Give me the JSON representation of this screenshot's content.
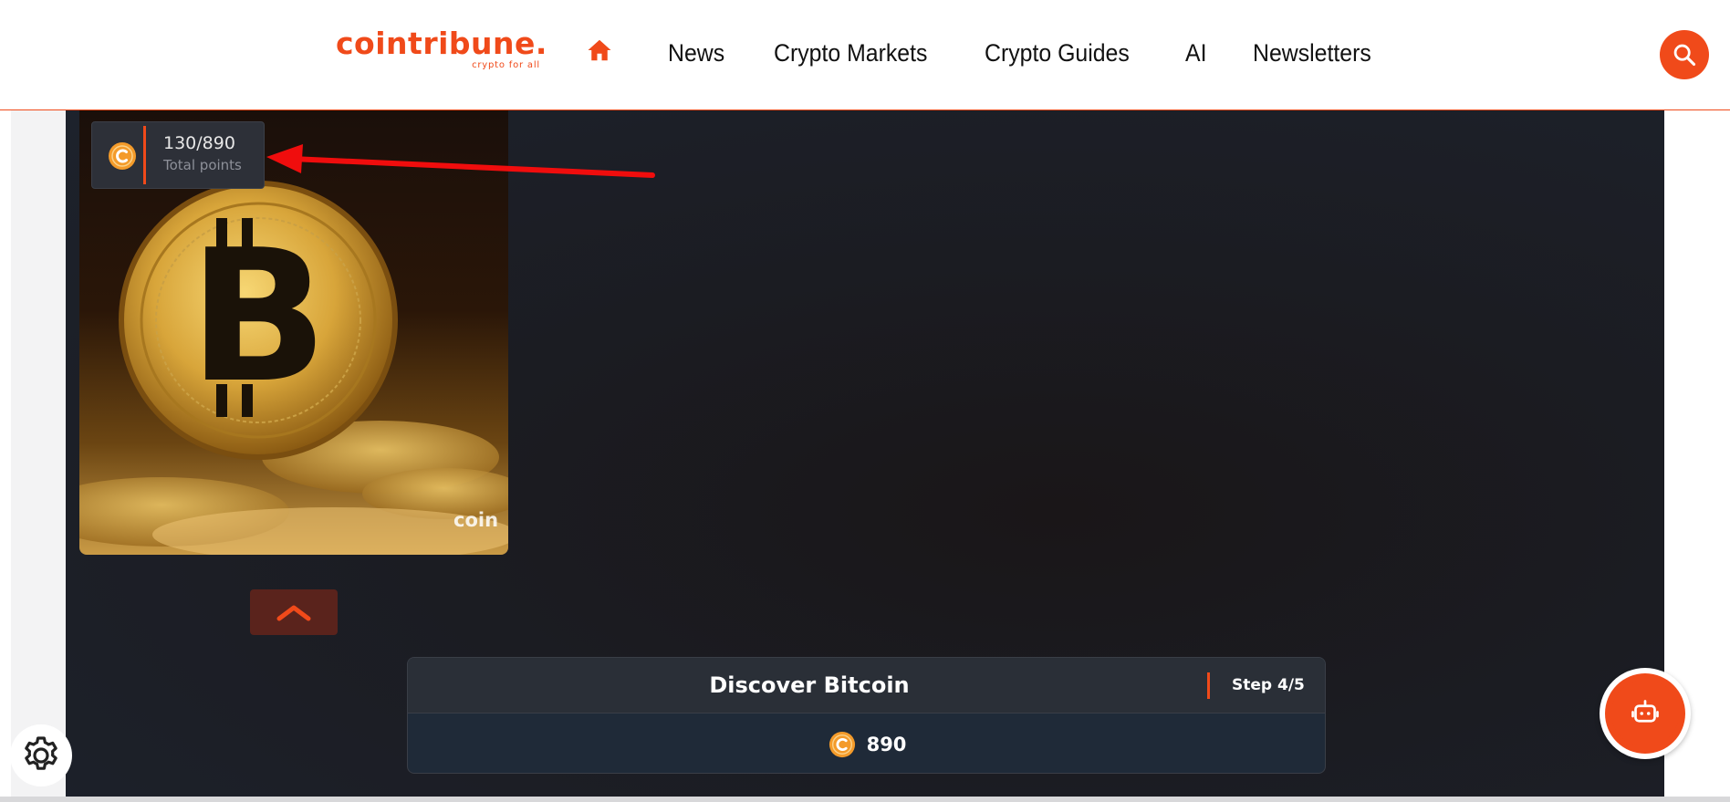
{
  "header": {
    "logo_text": "cointribune.",
    "logo_tagline": "crypto for all",
    "home_icon": "home-icon",
    "nav_items": [
      {
        "label": "News"
      },
      {
        "label": "Crypto Markets"
      },
      {
        "label": "Crypto Guides"
      },
      {
        "label": "AI"
      },
      {
        "label": "Newsletters"
      }
    ],
    "search_icon": "search-icon"
  },
  "points_badge": {
    "value": "130/890",
    "label": "Total points",
    "icon": "coin-icon"
  },
  "image_card": {
    "watermark": "coin",
    "subject": "bitcoin-coin-image"
  },
  "collapse_button": {
    "icon": "chevron-up-icon"
  },
  "step_card": {
    "title": "Discover Bitcoin",
    "step": "Step 4/5",
    "reward_value": "890",
    "reward_icon": "coin-icon"
  },
  "floating": {
    "settings_icon": "gear-icon",
    "chatbot_icon": "robot-icon"
  },
  "colors": {
    "accent": "#f04a1a",
    "panel_bg": "#1d222c",
    "badge_bg": "#2d3038",
    "collapse_bg": "#5a231c"
  }
}
